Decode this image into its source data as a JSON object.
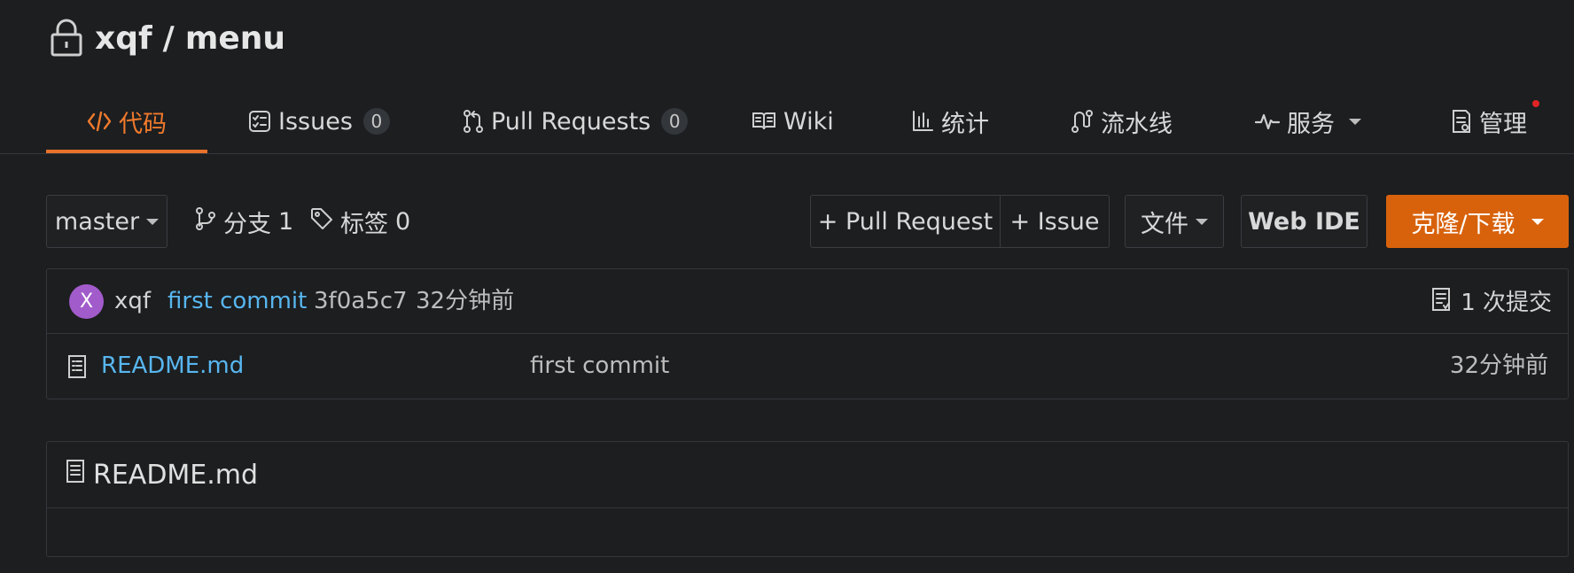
{
  "repo": {
    "owner": "xqf",
    "separator": "/",
    "name": "menu",
    "lock_icon": "lock-icon"
  },
  "tabs": [
    {
      "label": "代码",
      "icon": "code-icon",
      "active": true
    },
    {
      "label": "Issues",
      "icon": "issues-icon",
      "count": "0"
    },
    {
      "label": "Pull Requests",
      "icon": "pull-request-icon",
      "count": "0"
    },
    {
      "label": "Wiki",
      "icon": "book-icon"
    },
    {
      "label": "统计",
      "icon": "bar-chart-icon"
    },
    {
      "label": "流水线",
      "icon": "pipeline-icon"
    },
    {
      "label": "服务",
      "icon": "pulse-icon",
      "dropdown": true
    },
    {
      "label": "管理",
      "icon": "manage-icon",
      "has_notification": true
    }
  ],
  "toolbar": {
    "branch_select": "master",
    "branches_label": "分支",
    "branches_count": "1",
    "tags_label": "标签",
    "tags_count": "0",
    "new_pr": "+ Pull Request",
    "new_issue": "+ Issue",
    "file_menu": "文件",
    "web_ide": "Web IDE",
    "clone_download": "克隆/下载"
  },
  "latest_commit": {
    "avatar_letter": "X",
    "author": "xqf",
    "message": "first commit",
    "sha": "3f0a5c7",
    "time": "32分钟前",
    "commit_count_label": "1 次提交"
  },
  "files": [
    {
      "name": "README.md",
      "commit_message": "first commit",
      "time": "32分钟前",
      "icon": "file-text-icon"
    }
  ],
  "readme": {
    "title": "README.md"
  },
  "colors": {
    "accent": "#e8722a",
    "primary_button": "#d8620c",
    "link": "#58b6ef",
    "avatar": "#a25bcb",
    "background": "#1c1e20"
  }
}
